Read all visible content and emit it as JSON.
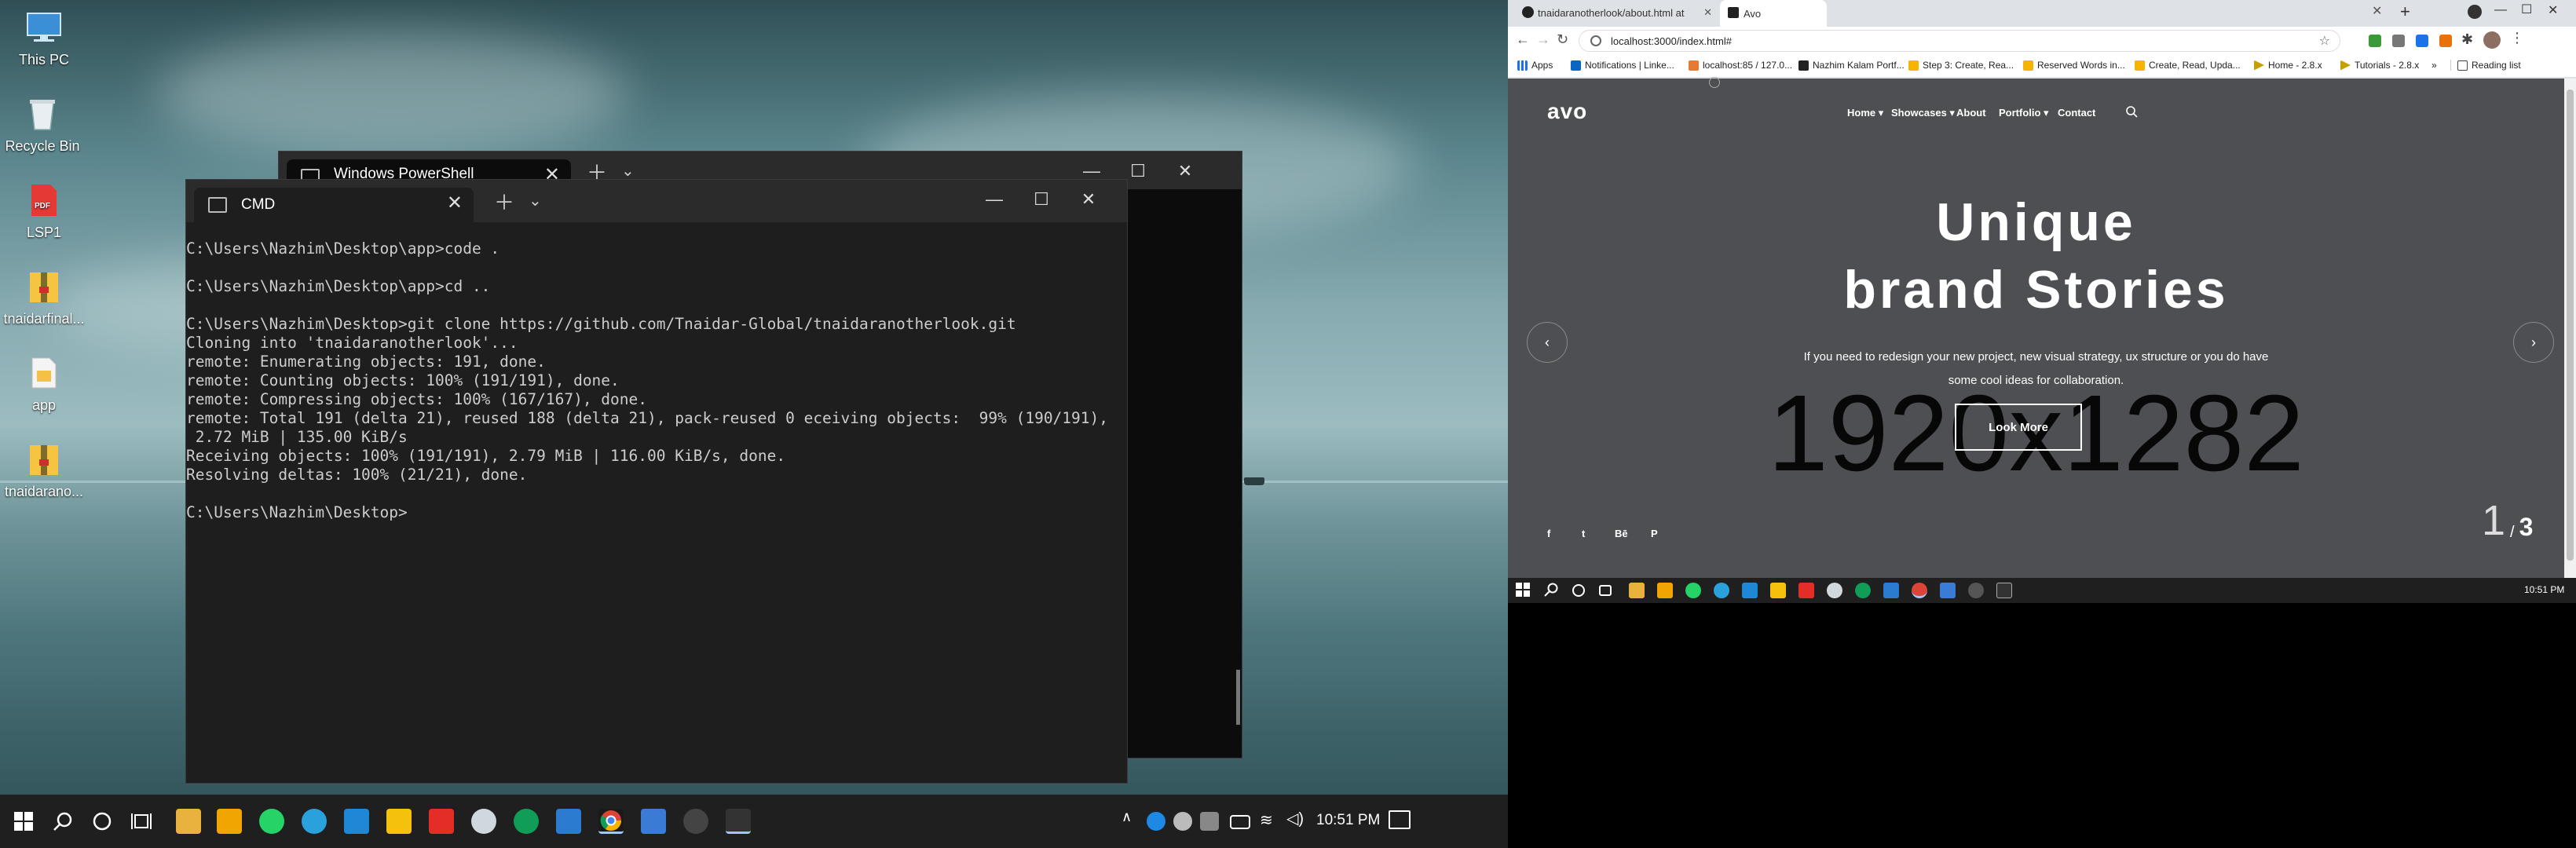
{
  "desktop": {
    "icons": [
      {
        "label": "This PC"
      },
      {
        "label": "Recycle Bin"
      },
      {
        "label": "LSP1"
      },
      {
        "label": "tnaidarfinal..."
      },
      {
        "label": "app"
      },
      {
        "label": "tnaidarano..."
      }
    ]
  },
  "powershell": {
    "tab_label": "Windows PowerShell"
  },
  "cmd": {
    "tab_label": "CMD",
    "lines": [
      "C:\\Users\\Nazhim\\Desktop\\app>code .",
      "",
      "C:\\Users\\Nazhim\\Desktop\\app>cd ..",
      "",
      "C:\\Users\\Nazhim\\Desktop>git clone https://github.com/Tnaidar-Global/tnaidaranotherlook.git",
      "Cloning into 'tnaidaranotherlook'...",
      "remote: Enumerating objects: 191, done.",
      "remote: Counting objects: 100% (191/191), done.",
      "remote: Compressing objects: 100% (167/167), done.",
      "remote: Total 191 (delta 21), reused 188 (delta 21), pack-reused 0 eceiving objects:  99% (190/191),",
      " 2.72 MiB | 135.00 KiB/s",
      "Receiving objects: 100% (191/191), 2.79 MiB | 116.00 KiB/s, done.",
      "Resolving deltas: 100% (21/21), done.",
      "",
      "C:\\Users\\Nazhim\\Desktop>"
    ]
  },
  "taskbar1": {
    "time": "10:51 PM"
  },
  "browser": {
    "tabs": [
      {
        "label": "tnaidaranotherlook/about.html at"
      },
      {
        "label": "Avo"
      }
    ],
    "address": "localhost:3000/index.html#",
    "bookmarks": [
      {
        "label": "Apps"
      },
      {
        "label": "Notifications | Linke..."
      },
      {
        "label": "localhost:85 / 127.0..."
      },
      {
        "label": "Nazhim Kalam Portf..."
      },
      {
        "label": "Step 3: Create, Rea..."
      },
      {
        "label": "Reserved Words in..."
      },
      {
        "label": "Create, Read, Upda..."
      },
      {
        "label": "Home - 2.8.x"
      },
      {
        "label": "Tutorials - 2.8.x"
      }
    ],
    "overflow": "»",
    "reading_list": "Reading list"
  },
  "site": {
    "logo": "avo",
    "nav": [
      {
        "label": "Home ▾"
      },
      {
        "label": "Showcases ▾"
      },
      {
        "label": "About"
      },
      {
        "label": "Portfolio ▾"
      },
      {
        "label": "Contact"
      }
    ],
    "hero_line1": "Unique",
    "hero_line2": "brand Stories",
    "subtitle_line1": "If you need to redesign your new project, new visual strategy, ux structure or you do have",
    "subtitle_line2": "some cool ideas for collaboration.",
    "placeholder": "1920x1282",
    "cta": "Look More",
    "slide_current": "1",
    "slide_sep": "/",
    "slide_total": "3",
    "social": [
      {
        "label": "f"
      },
      {
        "label": "t"
      },
      {
        "label": "Bē"
      },
      {
        "label": "P"
      }
    ]
  },
  "taskbar2": {
    "time": "10:51 PM"
  },
  "colors": {
    "terminal_bg": "#1e1e1e",
    "site_bg": "#4d4f52",
    "taskbar": "#1f1f1f",
    "chrome_frame": "#dee1e6"
  }
}
